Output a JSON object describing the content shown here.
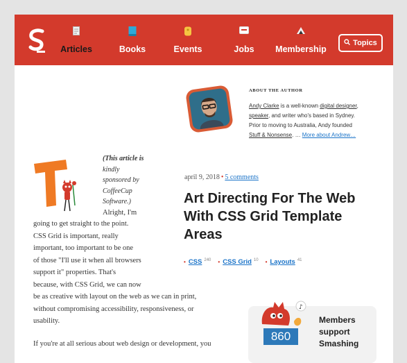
{
  "nav": {
    "items": [
      {
        "label": "Articles",
        "active": true
      },
      {
        "label": "Books"
      },
      {
        "label": "Events"
      },
      {
        "label": "Jobs"
      },
      {
        "label": "Membership"
      }
    ],
    "topics_label": "Topics"
  },
  "author": {
    "heading": "ABOUT THE AUTHOR",
    "name": "Andy Clarke",
    "t1": " is a well-known ",
    "link1": "digital designer",
    "t2": ",",
    "link2": "speaker",
    "t3": ", and writer who's based in Sydney.",
    "t4": "Prior to moving to Australia, Andy founded",
    "link3": "Stuff & Nonsense",
    "t5": ". … ",
    "more": "More about Andrew…"
  },
  "article": {
    "date": "april 9, 2018",
    "comments": "5 comments",
    "title_lines": [
      "Art Directing For The Web",
      "With CSS Grid Template",
      "Areas"
    ],
    "tags": [
      {
        "name": "CSS",
        "count": "240"
      },
      {
        "name": "CSS Grid",
        "count": "10"
      },
      {
        "name": "Layouts",
        "count": "41"
      }
    ],
    "sponsor_bold": "(This article is",
    "sponsor_lines": [
      "kindly",
      "sponsored by",
      "CoffeeCup",
      "Software.)"
    ],
    "alright": "Alright, I'm",
    "body_lines": [
      "going to get straight to the point.",
      "CSS Grid is important, really",
      "important, too important to be one",
      "of those \"I'll use it when all browsers",
      "support it\" properties. That's",
      "because, with CSS Grid, we can now",
      "be as creative with layout on the web as we can in print,",
      "without compromising accessibility, responsiveness, or",
      "usability."
    ],
    "next_paragraph": "If you're at all serious about web design or development, you"
  },
  "members": {
    "count": "860",
    "lines": [
      "Members",
      "support",
      "Smashing"
    ]
  },
  "colors": {
    "brand": "#d33a2c",
    "link": "#1a73c8",
    "counter": "#2d79b9"
  }
}
